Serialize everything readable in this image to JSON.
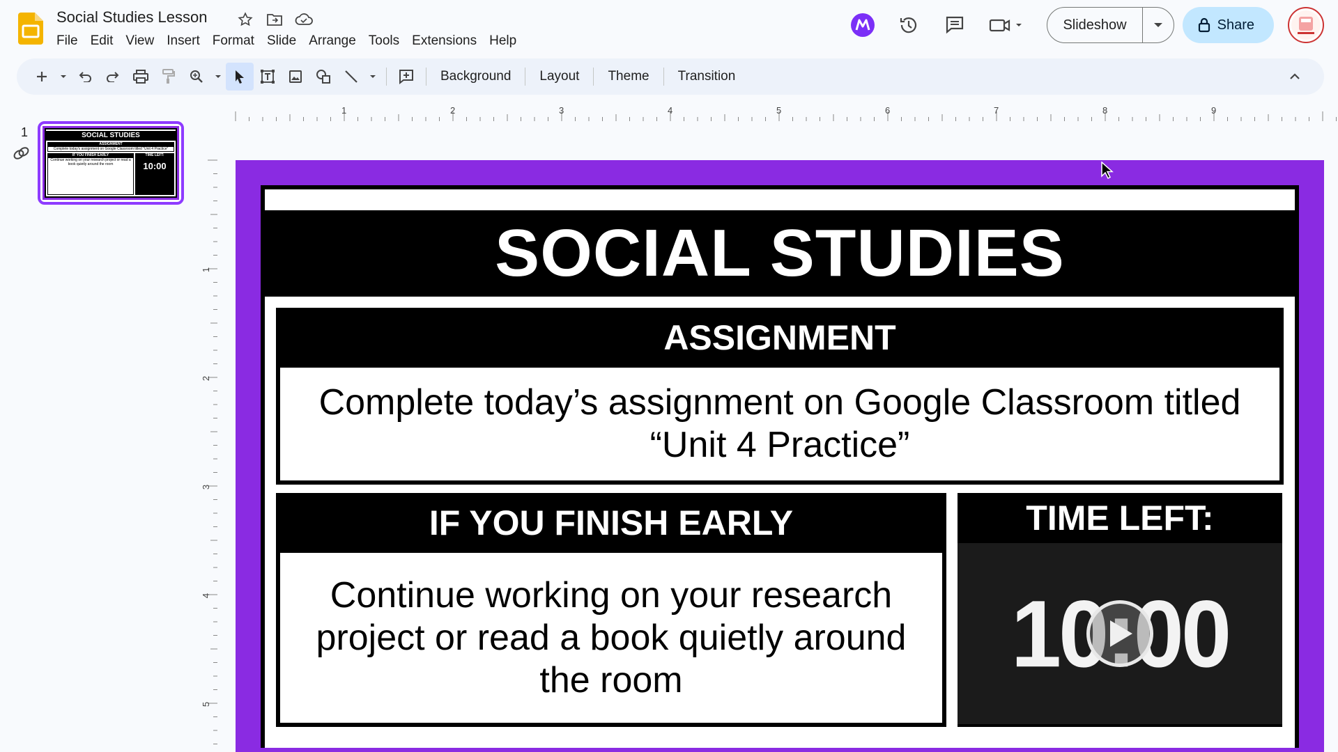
{
  "header": {
    "doc_title": "Social Studies Lesson",
    "menu": [
      "File",
      "Edit",
      "View",
      "Insert",
      "Format",
      "Slide",
      "Arrange",
      "Tools",
      "Extensions",
      "Help"
    ],
    "slideshow_label": "Slideshow",
    "share_label": "Share"
  },
  "toolbar": {
    "background_label": "Background",
    "layout_label": "Layout",
    "theme_label": "Theme",
    "transition_label": "Transition"
  },
  "filmstrip": {
    "slide_number": "1",
    "thumb_title": "SOCIAL STUDIES",
    "thumb_assignment_head": "ASSIGNMENT",
    "thumb_assignment_text": "Complete today's assignment on Google Classroom titled \"Unit 4 Practice\"",
    "thumb_finish_head": "IF YOU FINISH EARLY",
    "thumb_finish_text": "Continue working on your research project or read a book quietly around the room",
    "thumb_time_head": "TIME LEFT:",
    "thumb_time_value": "10:00"
  },
  "rulers": {
    "horizontal": [
      "1",
      "2",
      "3",
      "4",
      "5",
      "6",
      "7",
      "8",
      "9"
    ],
    "vertical": [
      "1",
      "2",
      "3",
      "4",
      "5"
    ]
  },
  "slide": {
    "title": "SOCIAL STUDIES",
    "assignment_head": "ASSIGNMENT",
    "assignment_text": "Complete today’s assignment on Google Classroom titled “Unit 4 Practice”",
    "finish_head": "IF YOU FINISH EARLY",
    "finish_text": "Continue working on your research project or read a book quietly around the room",
    "time_head": "TIME LEFT:",
    "time_value": "10:00"
  },
  "colors": {
    "slide_background": "#8a2be2",
    "share_button": "#c2e7ff",
    "logo": "#f4b400",
    "thumb_border": "#8e3bff"
  },
  "icons": {
    "title": [
      "star-icon",
      "move-to-folder-icon",
      "cloud-saved-icon"
    ],
    "top_right": [
      "addon-m-icon",
      "version-history-icon",
      "comments-icon",
      "meet-video-icon"
    ]
  }
}
